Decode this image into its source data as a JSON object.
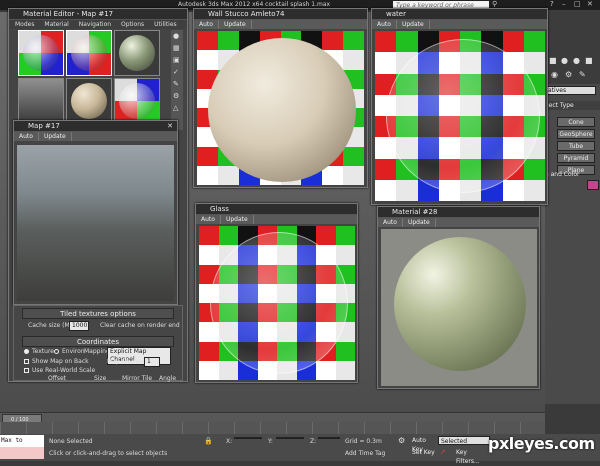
{
  "app": {
    "title": "Autodesk 3ds Max  2012 x64     cocktail splash 1.max",
    "search_placeholder": "Type a keyword or phrase"
  },
  "material_editor": {
    "title": "Material Editor - Map #17",
    "menu": [
      "Modes",
      "Material",
      "Navigation",
      "Options",
      "Utilities"
    ]
  },
  "map_window": {
    "title": "Map #17",
    "auto_label": "Auto",
    "update_label": "Update",
    "tiled_rollout_title": "Tiled textures options",
    "cache_label": "Cache size (MB):",
    "cache_value": "1000",
    "clear_cache_label": "Clear cache on render end",
    "coordinates_title": "Coordinates",
    "texture_label": "Texture",
    "environ_label": "Environ",
    "mapping_label": "Mapping:",
    "mapping_value": "Explicit Map Channel",
    "show_map_label": "Show Map on Back",
    "map_channel_label": "Map Channel:",
    "map_channel_value": "1",
    "real_world_label": "Use Real-World Scale",
    "offset_label": "Offset",
    "size_label": "Size",
    "mirror_label": "Mirror Tile",
    "angle_label": "Angle"
  },
  "stucco_window": {
    "title": "Wall Stucco Amleto74",
    "auto_label": "Auto",
    "update_label": "Update"
  },
  "water_window": {
    "title": "water",
    "auto_label": "Auto",
    "update_label": "Update"
  },
  "glass_window": {
    "title": "Glass",
    "auto_label": "Auto",
    "update_label": "Update"
  },
  "material28_window": {
    "title": "Material #28",
    "auto_label": "Auto",
    "update_label": "Update"
  },
  "command_panel": {
    "dropdown_value": "atives",
    "section_title": "ject Type",
    "buttons": [
      "Cone",
      "GeoSphere",
      "Tube",
      "Pyramid",
      "Plane"
    ],
    "color_section": "e and Color"
  },
  "timeline": {
    "counter": "0 / 100"
  },
  "status_bar": {
    "script_text": "Max to Physc.",
    "none_selected": "None Selected",
    "prompt": "Click or click-and-drag to select objects",
    "x_label": "X:",
    "y_label": "Y:",
    "z_label": "Z:",
    "grid": "Grid = 0.3m",
    "add_time_tag": "Add Time Tag",
    "auto_key": "Auto Key",
    "selected_value": "Selected",
    "set_key": "Set Key",
    "key_filters": "Key Filters..."
  },
  "watermark": "pxleyes.com"
}
